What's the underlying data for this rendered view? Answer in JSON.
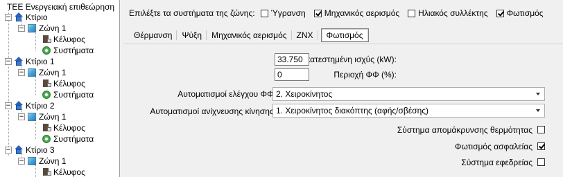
{
  "tree": {
    "root": "ΤΕΕ Ενεργειακή επιθεώρηση",
    "nodes": [
      {
        "label": "Κτίριο"
      },
      {
        "label": "Ζώνη 1"
      },
      {
        "label": "Κέλυφος"
      },
      {
        "label": "Συστήματα"
      },
      {
        "label": "Κτίριο 1"
      },
      {
        "label": "Ζώνη 1"
      },
      {
        "label": "Κέλυφος"
      },
      {
        "label": "Συστήματα"
      },
      {
        "label": "Κτίριο 2"
      },
      {
        "label": "Ζώνη 1"
      },
      {
        "label": "Κέλυφος"
      },
      {
        "label": "Συστήματα"
      },
      {
        "label": "Κτίριο 3"
      },
      {
        "label": "Ζώνη 1"
      },
      {
        "label": "Κέλυφος"
      }
    ],
    "expander_symbol": "−"
  },
  "zone_systems": {
    "lead": "Επιλέξτε τα συστήματα της ζώνης:",
    "options": [
      {
        "label": "Ύγρανση",
        "checked": false
      },
      {
        "label": "Μηχανικός αερισμός",
        "checked": true
      },
      {
        "label": "Ηλιακός συλλέκτης",
        "checked": false
      },
      {
        "label": "Φωτισμός",
        "checked": true
      }
    ]
  },
  "tabs": [
    {
      "label": "Θέρμανση",
      "active": false
    },
    {
      "label": "Ψύξη",
      "active": false
    },
    {
      "label": "Μηχανικός αερισμός",
      "active": false
    },
    {
      "label": "ΖΝΧ",
      "active": false
    },
    {
      "label": "Φωτισμός",
      "active": true
    }
  ],
  "lighting": {
    "installed_power_label": "Εγκατεστημένη ισχύς (kW):",
    "installed_power_value": "33.750",
    "daylight_area_label": "Περιοχή ΦΦ (%):",
    "daylight_area_value": "0",
    "daylight_control_label": "Αυτοματισμοί ελέγχου ΦΦ:",
    "daylight_control_value": "2. Χειροκίνητος",
    "motion_detection_label": "Αυτοματισμοί ανίχνευσης κίνησης:",
    "motion_detection_value": "1. Χειροκίνητος διακόπτης (αφής/σβέσης)",
    "heat_removal_label": "Σύστημα απομάκρυνσης θερμότητας",
    "heat_removal_checked": false,
    "safety_lighting_label": "Φωτισμός ασφαλείας",
    "safety_lighting_checked": true,
    "backup_system_label": "Σύστημα εφεδρείας",
    "backup_system_checked": false
  }
}
